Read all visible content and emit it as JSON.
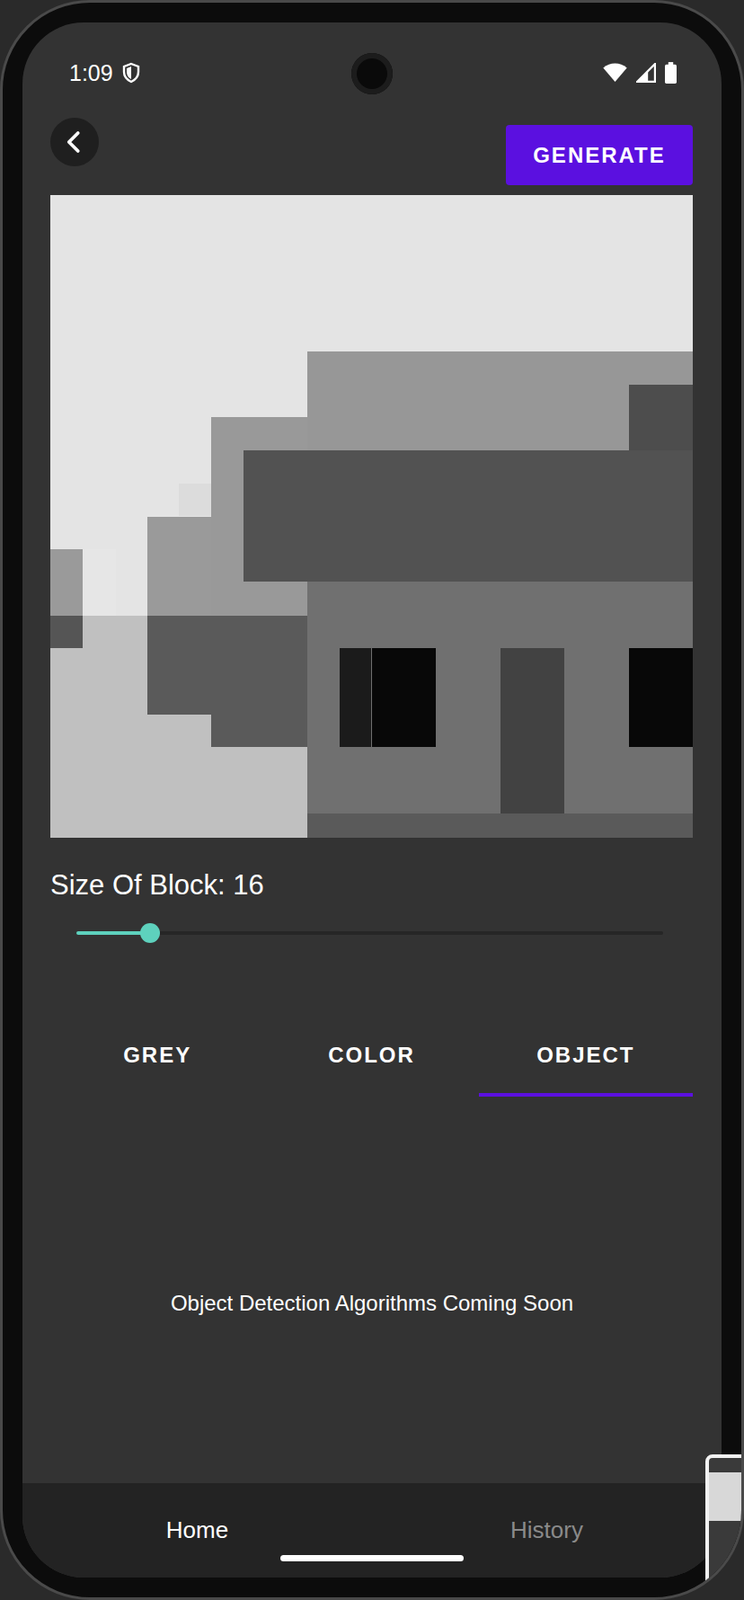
{
  "status_bar": {
    "time": "1:09"
  },
  "toolbar": {
    "action": "GENERATE"
  },
  "block_size": {
    "label": "Size Of Block: 16",
    "level": 0.125
  },
  "tabs": [
    {
      "label": "GREY",
      "selected": false
    },
    {
      "label": "COLOR",
      "selected": false
    },
    {
      "label": "OBJECT",
      "selected": true
    }
  ],
  "panel": {
    "message": "Object Detection Algorithms Coming Soon"
  },
  "bottom_nav": [
    {
      "label": "Home",
      "selected": true
    },
    {
      "label": "History",
      "selected": false
    }
  ]
}
